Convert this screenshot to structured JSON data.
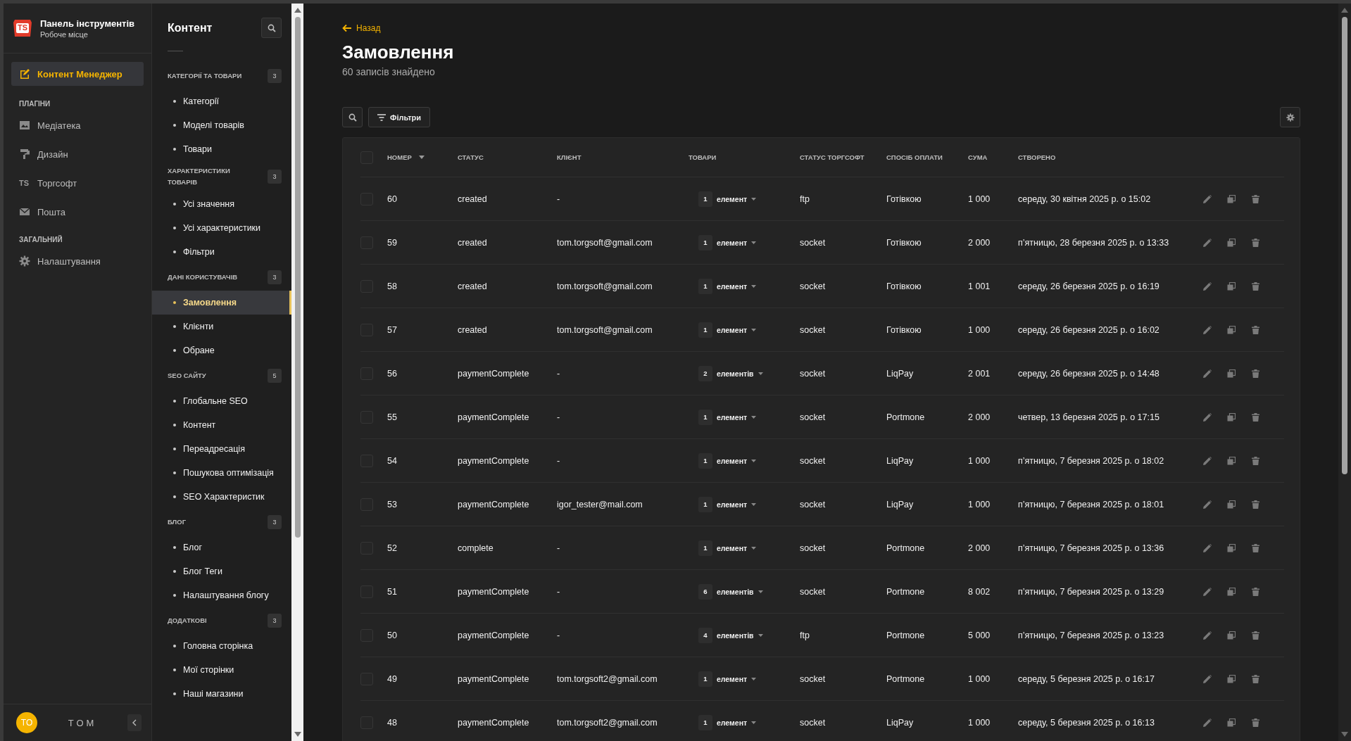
{
  "app": {
    "logo_text": "TS",
    "title": "Панель інструментів",
    "subtitle": "Робоче місце"
  },
  "rail": {
    "active": {
      "label": "Контент Менеджер",
      "selected": true
    },
    "groups": [
      {
        "heading": "ПЛАГІНИ",
        "items": [
          {
            "kind": "media",
            "label": "Медіатека",
            "selected": false
          },
          {
            "kind": "design",
            "label": "Дизайн",
            "selected": false
          },
          {
            "kind": "text-icon",
            "icon_text": "TS",
            "label": "Торгсофт",
            "selected": false
          },
          {
            "kind": "mail",
            "label": "Пошта",
            "selected": false
          }
        ]
      },
      {
        "heading": "ЗАГАЛЬНИЙ",
        "items": [
          {
            "kind": "settings",
            "label": "Налаштування",
            "selected": false
          }
        ]
      }
    ]
  },
  "user": {
    "initials": "TO",
    "name": "TOM"
  },
  "content_panel": {
    "title": "Контент",
    "sections": [
      {
        "heading": "КАТЕГОРІЇ ТА ТОВАРИ",
        "count": "3",
        "items": [
          {
            "label": "Категорії",
            "selected": false
          },
          {
            "label": "Моделі товарів",
            "selected": false
          },
          {
            "label": "Товари",
            "selected": false
          }
        ]
      },
      {
        "heading": "ХАРАКТЕРИСТИКИ ТОВАРІВ",
        "count": "3",
        "items": [
          {
            "label": "Усі значення",
            "selected": false
          },
          {
            "label": "Усі характеристики",
            "selected": false
          },
          {
            "label": "Фільтри",
            "selected": false
          }
        ]
      },
      {
        "heading": "ДАНІ КОРИСТУВАЧІВ",
        "count": "3",
        "items": [
          {
            "label": "Замовлення",
            "selected": true
          },
          {
            "label": "Клієнти",
            "selected": false
          },
          {
            "label": "Обране",
            "selected": false
          }
        ]
      },
      {
        "heading": "SEO САЙТУ",
        "count": "5",
        "items": [
          {
            "label": "Глобальне SEO",
            "selected": false
          },
          {
            "label": "Контент",
            "selected": false
          },
          {
            "label": "Переадресація",
            "selected": false
          },
          {
            "label": "Пошукова оптимізація",
            "selected": false
          },
          {
            "label": "SEO Характеристик",
            "selected": false
          }
        ]
      },
      {
        "heading": "БЛОГ",
        "count": "3",
        "items": [
          {
            "label": "Блог",
            "selected": false
          },
          {
            "label": "Блог Теги",
            "selected": false
          },
          {
            "label": "Налаштування блогу",
            "selected": false
          }
        ]
      },
      {
        "heading": "ДОДАТКОВІ",
        "count": "3",
        "items": [
          {
            "label": "Головна сторінка",
            "selected": false
          },
          {
            "label": "Мої сторінки",
            "selected": false
          },
          {
            "label": "Наші магазини",
            "selected": false
          }
        ]
      }
    ]
  },
  "page": {
    "back_link": "Назад",
    "title": "Замовлення",
    "subtitle": "60 записів знайдено",
    "filter_button": "Фільтри"
  },
  "table": {
    "all_selected": false,
    "columns": [
      {
        "label": "НОМЕР",
        "sorted": true
      },
      {
        "label": "СТАТУС",
        "sorted": false
      },
      {
        "label": "КЛІЄНТ",
        "sorted": false
      },
      {
        "label": "ТОВАРИ",
        "sorted": false
      },
      {
        "label": "СТАТУС ТОРГСОФТ",
        "sorted": false
      },
      {
        "label": "СПОСІБ ОПЛАТИ",
        "sorted": false
      },
      {
        "label": "СУМА",
        "sorted": false
      },
      {
        "label": "СТВОРЕНО",
        "sorted": false
      }
    ],
    "rows": [
      {
        "selected": false,
        "number": "60",
        "status": "created",
        "client": "-",
        "items_count": "1",
        "items_label": "елемент",
        "torgsoft_status": "ftp",
        "payment": "Готівкою",
        "sum": "1 000",
        "created": "середу, 30 квітня 2025 р. о 15:02"
      },
      {
        "selected": false,
        "number": "59",
        "status": "created",
        "client": "tom.torgsoft@gmail.com",
        "items_count": "1",
        "items_label": "елемент",
        "torgsoft_status": "socket",
        "payment": "Готівкою",
        "sum": "2 000",
        "created": "п’ятницю, 28 березня 2025 р. о 13:33"
      },
      {
        "selected": false,
        "number": "58",
        "status": "created",
        "client": "tom.torgsoft@gmail.com",
        "items_count": "1",
        "items_label": "елемент",
        "torgsoft_status": "socket",
        "payment": "Готівкою",
        "sum": "1 001",
        "created": "середу, 26 березня 2025 р. о 16:19"
      },
      {
        "selected": false,
        "number": "57",
        "status": "created",
        "client": "tom.torgsoft@gmail.com",
        "items_count": "1",
        "items_label": "елемент",
        "torgsoft_status": "socket",
        "payment": "Готівкою",
        "sum": "1 000",
        "created": "середу, 26 березня 2025 р. о 16:02"
      },
      {
        "selected": false,
        "number": "56",
        "status": "paymentComplete",
        "client": "-",
        "items_count": "2",
        "items_label": "елементів",
        "torgsoft_status": "socket",
        "payment": "LiqPay",
        "sum": "2 001",
        "created": "середу, 26 березня 2025 р. о 14:48"
      },
      {
        "selected": false,
        "number": "55",
        "status": "paymentComplete",
        "client": "-",
        "items_count": "1",
        "items_label": "елемент",
        "torgsoft_status": "socket",
        "payment": "Portmone",
        "sum": "2 000",
        "created": "четвер, 13 березня 2025 р. о 17:15"
      },
      {
        "selected": false,
        "number": "54",
        "status": "paymentComplete",
        "client": "-",
        "items_count": "1",
        "items_label": "елемент",
        "torgsoft_status": "socket",
        "payment": "LiqPay",
        "sum": "1 000",
        "created": "п’ятницю, 7 березня 2025 р. о 18:02"
      },
      {
        "selected": false,
        "number": "53",
        "status": "paymentComplete",
        "client": "igor_tester@mail.com",
        "items_count": "1",
        "items_label": "елемент",
        "torgsoft_status": "socket",
        "payment": "LiqPay",
        "sum": "1 000",
        "created": "п’ятницю, 7 березня 2025 р. о 18:01"
      },
      {
        "selected": false,
        "number": "52",
        "status": "complete",
        "client": "-",
        "items_count": "1",
        "items_label": "елемент",
        "torgsoft_status": "socket",
        "payment": "Portmone",
        "sum": "2 000",
        "created": "п’ятницю, 7 березня 2025 р. о 13:36"
      },
      {
        "selected": false,
        "number": "51",
        "status": "paymentComplete",
        "client": "-",
        "items_count": "6",
        "items_label": "елементів",
        "torgsoft_status": "socket",
        "payment": "Portmone",
        "sum": "8 002",
        "created": "п’ятницю, 7 березня 2025 р. о 13:29"
      },
      {
        "selected": false,
        "number": "50",
        "status": "paymentComplete",
        "client": "-",
        "items_count": "4",
        "items_label": "елементів",
        "torgsoft_status": "ftp",
        "payment": "Portmone",
        "sum": "5 000",
        "created": "п’ятницю, 7 березня 2025 р. о 13:23"
      },
      {
        "selected": false,
        "number": "49",
        "status": "paymentComplete",
        "client": "tom.torgsoft2@gmail.com",
        "items_count": "1",
        "items_label": "елемент",
        "torgsoft_status": "socket",
        "payment": "Portmone",
        "sum": "1 000",
        "created": "середу, 5 березня 2025 р. о 16:17"
      },
      {
        "selected": false,
        "number": "48",
        "status": "paymentComplete",
        "client": "tom.torgsoft2@gmail.com",
        "items_count": "1",
        "items_label": "елемент",
        "torgsoft_status": "socket",
        "payment": "LiqPay",
        "sum": "1 000",
        "created": "середу, 5 березня 2025 р. о 16:13"
      }
    ]
  }
}
